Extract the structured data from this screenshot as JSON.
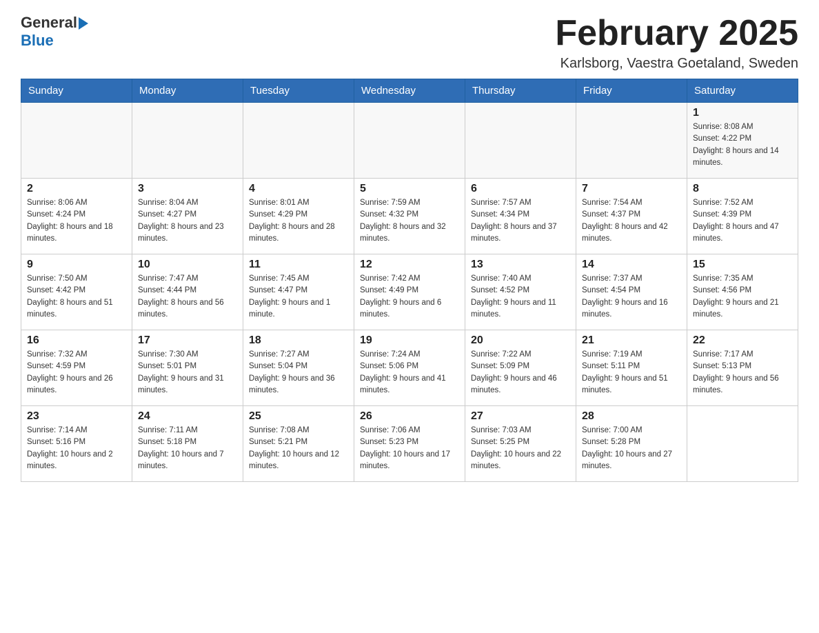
{
  "header": {
    "logo_general": "General",
    "logo_blue": "Blue",
    "month_title": "February 2025",
    "location": "Karlsborg, Vaestra Goetaland, Sweden"
  },
  "weekdays": [
    "Sunday",
    "Monday",
    "Tuesday",
    "Wednesday",
    "Thursday",
    "Friday",
    "Saturday"
  ],
  "weeks": [
    [
      {
        "day": "",
        "sunrise": "",
        "sunset": "",
        "daylight": ""
      },
      {
        "day": "",
        "sunrise": "",
        "sunset": "",
        "daylight": ""
      },
      {
        "day": "",
        "sunrise": "",
        "sunset": "",
        "daylight": ""
      },
      {
        "day": "",
        "sunrise": "",
        "sunset": "",
        "daylight": ""
      },
      {
        "day": "",
        "sunrise": "",
        "sunset": "",
        "daylight": ""
      },
      {
        "day": "",
        "sunrise": "",
        "sunset": "",
        "daylight": ""
      },
      {
        "day": "1",
        "sunrise": "Sunrise: 8:08 AM",
        "sunset": "Sunset: 4:22 PM",
        "daylight": "Daylight: 8 hours and 14 minutes."
      }
    ],
    [
      {
        "day": "2",
        "sunrise": "Sunrise: 8:06 AM",
        "sunset": "Sunset: 4:24 PM",
        "daylight": "Daylight: 8 hours and 18 minutes."
      },
      {
        "day": "3",
        "sunrise": "Sunrise: 8:04 AM",
        "sunset": "Sunset: 4:27 PM",
        "daylight": "Daylight: 8 hours and 23 minutes."
      },
      {
        "day": "4",
        "sunrise": "Sunrise: 8:01 AM",
        "sunset": "Sunset: 4:29 PM",
        "daylight": "Daylight: 8 hours and 28 minutes."
      },
      {
        "day": "5",
        "sunrise": "Sunrise: 7:59 AM",
        "sunset": "Sunset: 4:32 PM",
        "daylight": "Daylight: 8 hours and 32 minutes."
      },
      {
        "day": "6",
        "sunrise": "Sunrise: 7:57 AM",
        "sunset": "Sunset: 4:34 PM",
        "daylight": "Daylight: 8 hours and 37 minutes."
      },
      {
        "day": "7",
        "sunrise": "Sunrise: 7:54 AM",
        "sunset": "Sunset: 4:37 PM",
        "daylight": "Daylight: 8 hours and 42 minutes."
      },
      {
        "day": "8",
        "sunrise": "Sunrise: 7:52 AM",
        "sunset": "Sunset: 4:39 PM",
        "daylight": "Daylight: 8 hours and 47 minutes."
      }
    ],
    [
      {
        "day": "9",
        "sunrise": "Sunrise: 7:50 AM",
        "sunset": "Sunset: 4:42 PM",
        "daylight": "Daylight: 8 hours and 51 minutes."
      },
      {
        "day": "10",
        "sunrise": "Sunrise: 7:47 AM",
        "sunset": "Sunset: 4:44 PM",
        "daylight": "Daylight: 8 hours and 56 minutes."
      },
      {
        "day": "11",
        "sunrise": "Sunrise: 7:45 AM",
        "sunset": "Sunset: 4:47 PM",
        "daylight": "Daylight: 9 hours and 1 minute."
      },
      {
        "day": "12",
        "sunrise": "Sunrise: 7:42 AM",
        "sunset": "Sunset: 4:49 PM",
        "daylight": "Daylight: 9 hours and 6 minutes."
      },
      {
        "day": "13",
        "sunrise": "Sunrise: 7:40 AM",
        "sunset": "Sunset: 4:52 PM",
        "daylight": "Daylight: 9 hours and 11 minutes."
      },
      {
        "day": "14",
        "sunrise": "Sunrise: 7:37 AM",
        "sunset": "Sunset: 4:54 PM",
        "daylight": "Daylight: 9 hours and 16 minutes."
      },
      {
        "day": "15",
        "sunrise": "Sunrise: 7:35 AM",
        "sunset": "Sunset: 4:56 PM",
        "daylight": "Daylight: 9 hours and 21 minutes."
      }
    ],
    [
      {
        "day": "16",
        "sunrise": "Sunrise: 7:32 AM",
        "sunset": "Sunset: 4:59 PM",
        "daylight": "Daylight: 9 hours and 26 minutes."
      },
      {
        "day": "17",
        "sunrise": "Sunrise: 7:30 AM",
        "sunset": "Sunset: 5:01 PM",
        "daylight": "Daylight: 9 hours and 31 minutes."
      },
      {
        "day": "18",
        "sunrise": "Sunrise: 7:27 AM",
        "sunset": "Sunset: 5:04 PM",
        "daylight": "Daylight: 9 hours and 36 minutes."
      },
      {
        "day": "19",
        "sunrise": "Sunrise: 7:24 AM",
        "sunset": "Sunset: 5:06 PM",
        "daylight": "Daylight: 9 hours and 41 minutes."
      },
      {
        "day": "20",
        "sunrise": "Sunrise: 7:22 AM",
        "sunset": "Sunset: 5:09 PM",
        "daylight": "Daylight: 9 hours and 46 minutes."
      },
      {
        "day": "21",
        "sunrise": "Sunrise: 7:19 AM",
        "sunset": "Sunset: 5:11 PM",
        "daylight": "Daylight: 9 hours and 51 minutes."
      },
      {
        "day": "22",
        "sunrise": "Sunrise: 7:17 AM",
        "sunset": "Sunset: 5:13 PM",
        "daylight": "Daylight: 9 hours and 56 minutes."
      }
    ],
    [
      {
        "day": "23",
        "sunrise": "Sunrise: 7:14 AM",
        "sunset": "Sunset: 5:16 PM",
        "daylight": "Daylight: 10 hours and 2 minutes."
      },
      {
        "day": "24",
        "sunrise": "Sunrise: 7:11 AM",
        "sunset": "Sunset: 5:18 PM",
        "daylight": "Daylight: 10 hours and 7 minutes."
      },
      {
        "day": "25",
        "sunrise": "Sunrise: 7:08 AM",
        "sunset": "Sunset: 5:21 PM",
        "daylight": "Daylight: 10 hours and 12 minutes."
      },
      {
        "day": "26",
        "sunrise": "Sunrise: 7:06 AM",
        "sunset": "Sunset: 5:23 PM",
        "daylight": "Daylight: 10 hours and 17 minutes."
      },
      {
        "day": "27",
        "sunrise": "Sunrise: 7:03 AM",
        "sunset": "Sunset: 5:25 PM",
        "daylight": "Daylight: 10 hours and 22 minutes."
      },
      {
        "day": "28",
        "sunrise": "Sunrise: 7:00 AM",
        "sunset": "Sunset: 5:28 PM",
        "daylight": "Daylight: 10 hours and 27 minutes."
      },
      {
        "day": "",
        "sunrise": "",
        "sunset": "",
        "daylight": ""
      }
    ]
  ]
}
